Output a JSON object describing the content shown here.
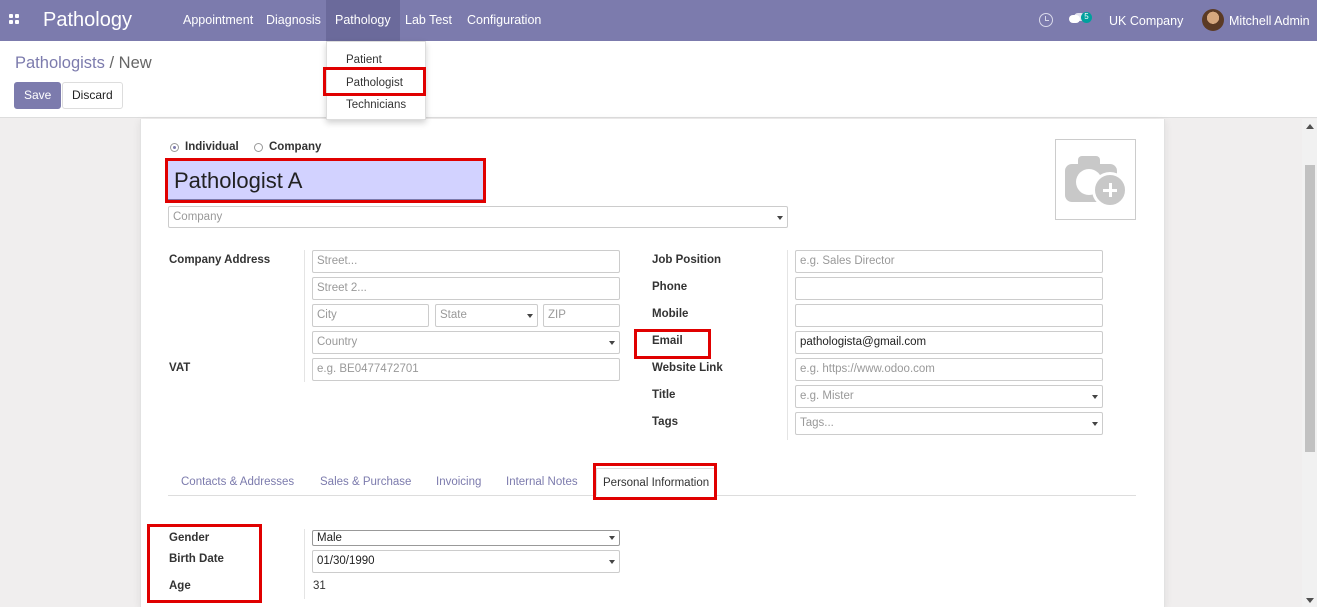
{
  "app": {
    "brand": "Pathology",
    "menu": [
      "Appointment",
      "Diagnosis",
      "Pathology",
      "Lab Test",
      "Configuration"
    ],
    "company": "UK Company",
    "user": "Mitchell Admin",
    "message_count": "5",
    "accent_color": "#7c7bad"
  },
  "breadcrumb": {
    "parent": "Pathologists",
    "separator": " / ",
    "current": "New"
  },
  "buttons": {
    "save": "Save",
    "discard": "Discard"
  },
  "pathology_menu": {
    "items": [
      "Patient",
      "Pathologist",
      "Technicians"
    ]
  },
  "form": {
    "type_options": [
      "Individual",
      "Company"
    ],
    "selected_type": "Individual",
    "name": "Pathologist A",
    "company_placeholder": "Company",
    "address_label": "Company Address",
    "street_placeholder": "Street...",
    "street2_placeholder": "Street 2...",
    "city_placeholder": "City",
    "state_placeholder": "State",
    "zip_placeholder": "ZIP",
    "country_placeholder": "Country",
    "vat_label": "VAT",
    "vat_placeholder": "e.g. BE0477472701",
    "job_position_label": "Job Position",
    "job_position_placeholder": "e.g. Sales Director",
    "phone_label": "Phone",
    "mobile_label": "Mobile",
    "email_label": "Email",
    "email_value": "pathologista@gmail.com",
    "website_label": "Website Link",
    "website_placeholder": "e.g. https://www.odoo.com",
    "title_label": "Title",
    "title_placeholder": "e.g. Mister",
    "tags_label": "Tags",
    "tags_placeholder": "Tags..."
  },
  "tabs": [
    "Contacts & Addresses",
    "Sales & Purchase",
    "Invoicing",
    "Internal Notes",
    "Personal Information"
  ],
  "personal": {
    "gender_label": "Gender",
    "gender_value": "Male",
    "birth_label": "Birth Date",
    "birth_value": "01/30/1990",
    "age_label": "Age",
    "age_value": "31"
  },
  "icons": [
    "apps-icon",
    "clock-icon",
    "chat-icon",
    "avatar",
    "camera-icon",
    "caret-down-icon"
  ]
}
